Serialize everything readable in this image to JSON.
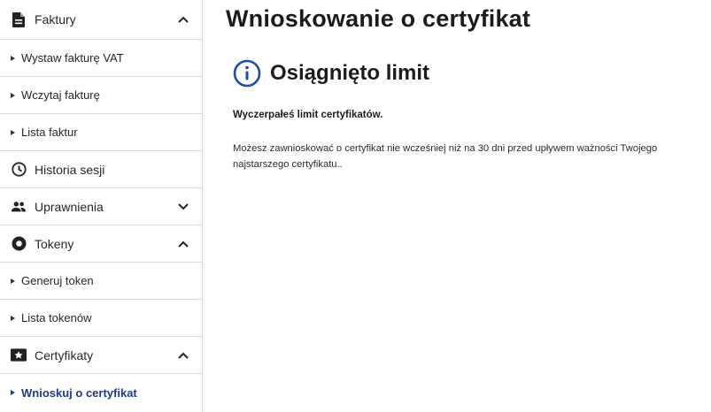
{
  "sidebar": {
    "items": [
      {
        "label": "Faktury",
        "icon": "document-icon",
        "expanded": true
      },
      {
        "label": "Wystaw fakturę VAT"
      },
      {
        "label": "Wczytaj fakturę"
      },
      {
        "label": "Lista faktur"
      },
      {
        "label": "Historia sesji",
        "icon": "clock-icon"
      },
      {
        "label": "Uprawnienia",
        "icon": "users-icon",
        "expanded": false
      },
      {
        "label": "Tokeny",
        "icon": "token-icon",
        "expanded": true
      },
      {
        "label": "Generuj token"
      },
      {
        "label": "Lista tokenów"
      },
      {
        "label": "Certyfikaty",
        "icon": "certificate-icon",
        "expanded": true
      },
      {
        "label": "Wnioskuj o certyfikat",
        "active": true
      }
    ]
  },
  "main": {
    "title": "Wnioskowanie o certyfikat",
    "alert": {
      "title": "Osiągnięto limit",
      "icon": "info-icon",
      "strong": "Wyczerpałeś limit certyfikatów.",
      "body": "Możesz zawnioskować o certyfikat nie wcześniej niż na 30 dni przed upływem ważności Twojego najstarszego certyfikatu.."
    }
  },
  "colors": {
    "accent": "#1e3a8a",
    "info_icon": "#1e4fa8"
  }
}
